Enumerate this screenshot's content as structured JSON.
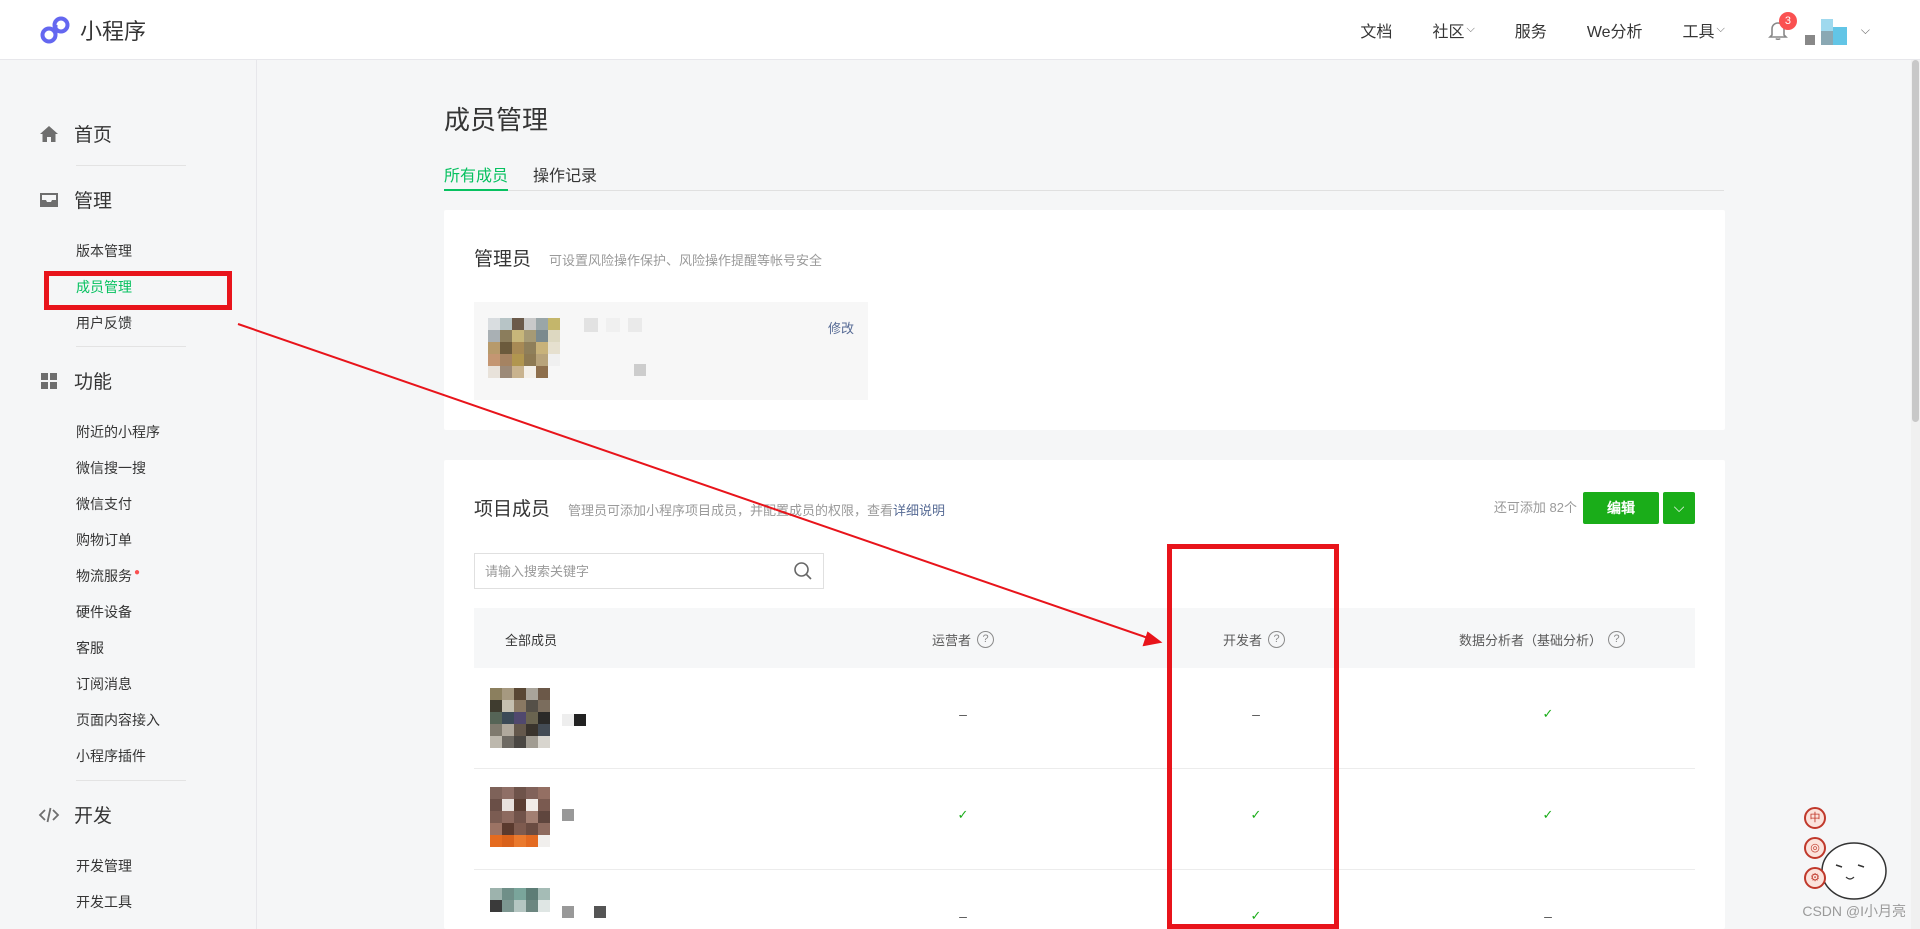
{
  "app": {
    "title": "小程序"
  },
  "topnav": {
    "items": [
      {
        "label": "文档",
        "chevron": false
      },
      {
        "label": "社区",
        "chevron": true
      },
      {
        "label": "服务",
        "chevron": false
      },
      {
        "label": "We分析",
        "chevron": false
      },
      {
        "label": "工具",
        "chevron": true
      }
    ],
    "notification_count": "3",
    "chevron_glyph": "⌵"
  },
  "sidebar": {
    "home": {
      "label": "首页",
      "icon": "home-icon"
    },
    "manage": {
      "label": "管理",
      "icon": "inbox-icon",
      "items": [
        "版本管理",
        "成员管理",
        "用户反馈"
      ],
      "active": "成员管理"
    },
    "features": {
      "label": "功能",
      "icon": "grid-icon",
      "items": [
        "附近的小程序",
        "微信搜一搜",
        "微信支付",
        "购物订单",
        "物流服务",
        "硬件设备",
        "客服",
        "订阅消息",
        "页面内容接入",
        "小程序插件"
      ]
    },
    "develop": {
      "label": "开发",
      "icon": "code-icon",
      "items": [
        "开发管理",
        "开发工具"
      ]
    }
  },
  "page": {
    "title": "成员管理",
    "tabs": [
      "所有成员",
      "操作记录"
    ],
    "active_tab": "所有成员"
  },
  "admin_card": {
    "title": "管理员",
    "desc": "可设置风险操作保护、风险操作提醒等帐号安全",
    "edit_label": "修改"
  },
  "members_card": {
    "title": "项目成员",
    "desc_prefix": "管理员可添加小程序项目成员，并配置成员的权限，查看",
    "desc_link": "详细说明",
    "quota": "还可添加 82个",
    "edit_button": "编辑",
    "search_placeholder": "请输入搜索关键字",
    "columns": [
      "全部成员",
      "运营者",
      "开发者",
      "数据分析者（基础分析）"
    ],
    "question_mark": "?",
    "rows": [
      {
        "operator": "–",
        "developer": "–",
        "analyst": "✓"
      },
      {
        "operator": "✓",
        "developer": "✓",
        "analyst": "✓"
      },
      {
        "operator": "–",
        "developer": "✓",
        "analyst": "–"
      }
    ]
  },
  "watermark": "CSDN @I小月亮",
  "mascot_labels": [
    "中",
    "◎",
    "⚙"
  ],
  "colors": {
    "accent_green": "#07c160",
    "button_green": "#1aad19",
    "annotation_red": "#e8141b",
    "badge_red": "#fa5151",
    "link_blue": "#576b95"
  }
}
